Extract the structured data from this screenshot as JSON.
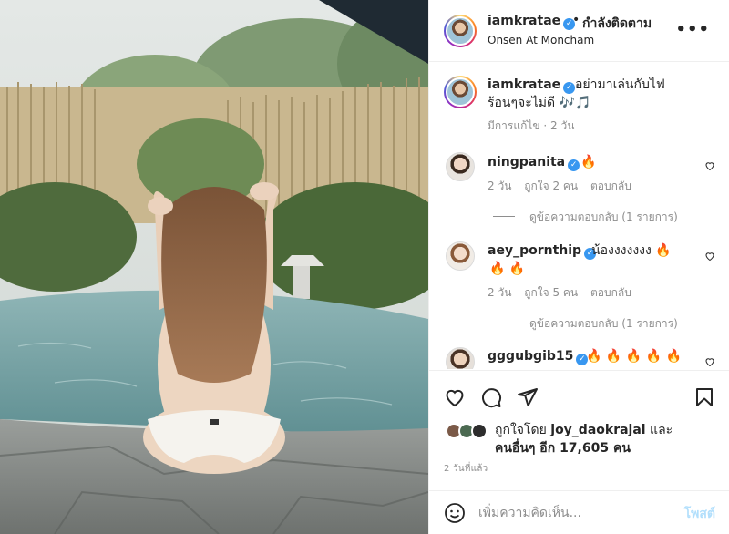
{
  "post": {
    "photo_alt": "Woman in white bikini sitting at onsen pool with bamboo fence"
  },
  "header": {
    "username": "iamkratae",
    "separator": "•",
    "follow_label": "กำลังติดตาม",
    "location": "Onsen At Moncham",
    "more_label": "•••"
  },
  "caption": {
    "username": "iamkratae",
    "text_line1": "อย่ามาเล่นกับไฟ",
    "text_line2": "ร้อนๆจะไม่ดี 🎶🎵",
    "meta": "มีการแก้ไข · 2 วัน"
  },
  "comments": [
    {
      "username": "ningpanita",
      "text": "🔥",
      "time": "2 วัน",
      "likes": "ถูกใจ 2 คน",
      "reply_label": "ตอบกลับ",
      "view_replies": "ดูข้อความตอบกลับ (1 รายการ)"
    },
    {
      "username": "aey_pornthip",
      "text": "น้องงงงงงง 🔥",
      "text_line2": "🔥 🔥",
      "time": "2 วัน",
      "likes": "ถูกใจ 5 คน",
      "reply_label": "ตอบกลับ",
      "view_replies": "ดูข้อความตอบกลับ (1 รายการ)"
    },
    {
      "username": "gggubgib15",
      "text": "🔥 🔥 🔥 🔥 🔥"
    }
  ],
  "likes": {
    "prefix": "ถูกใจโดย ",
    "user": "joy_daokrajai",
    "and": " และ",
    "others": "คนอื่นๆ อีก 17,605 คน"
  },
  "timestamp": "2 วันที่แล้ว",
  "add_comment": {
    "placeholder": "เพิ่มความคิดเห็น...",
    "post_label": "โพสต์"
  },
  "colors": {
    "verified": "#3897f0",
    "post_button_disabled": "#b2dffc",
    "muted": "#8e8e8e"
  },
  "icons": [
    "heart-icon",
    "comment-icon",
    "share-icon",
    "bookmark-icon",
    "smile-icon",
    "verified-icon",
    "more-icon"
  ]
}
